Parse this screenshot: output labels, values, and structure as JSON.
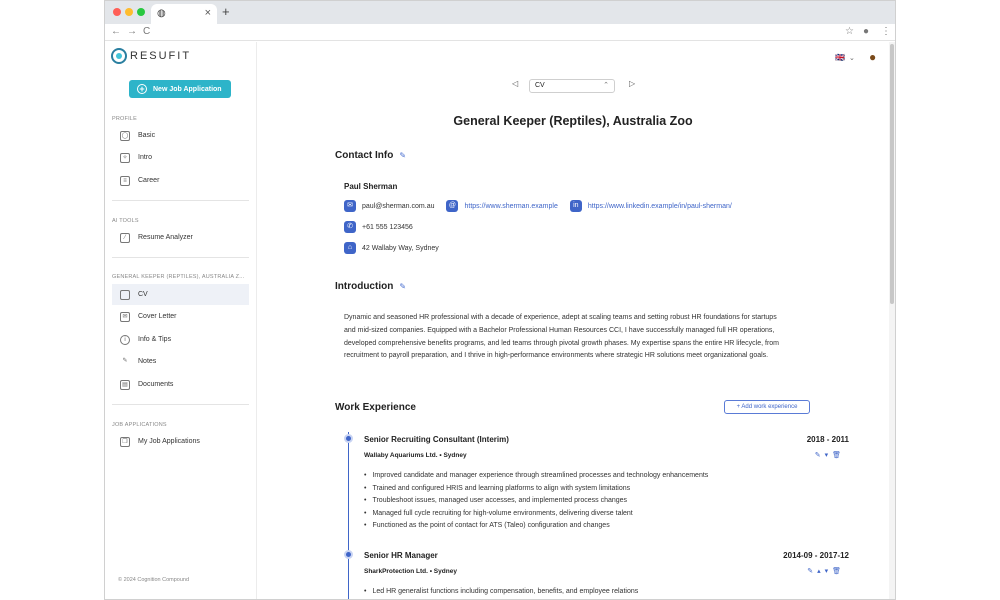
{
  "browser": {
    "tab_icon": "globe-icon",
    "tab_close": "×",
    "new_tab": "+",
    "nav": {
      "back": "←",
      "forward": "→",
      "reload": "C"
    },
    "star": "☆",
    "menu": "⋮"
  },
  "brand": {
    "name": "RESUFIT"
  },
  "sidebar": {
    "new_button": "New Job Application",
    "sections": [
      {
        "label": "PROFILE",
        "items": [
          {
            "label": "Basic",
            "icon": "user-icon"
          },
          {
            "label": "Intro",
            "icon": "sparkle-icon"
          },
          {
            "label": "Career",
            "icon": "list-icon"
          }
        ]
      },
      {
        "label": "AI TOOLS",
        "items": [
          {
            "label": "Resume Analyzer",
            "icon": "wand-icon"
          }
        ]
      },
      {
        "label": "GENERAL KEEPER (REPTILES), AUSTRALIA Z...",
        "items": [
          {
            "label": "CV",
            "icon": "document-icon"
          },
          {
            "label": "Cover Letter",
            "icon": "mail-icon"
          },
          {
            "label": "Info & Tips",
            "icon": "info-icon"
          },
          {
            "label": "Notes",
            "icon": "pencil-icon"
          },
          {
            "label": "Documents",
            "icon": "file-icon"
          }
        ]
      },
      {
        "label": "JOB APPLICATIONS",
        "items": [
          {
            "label": "My Job Applications",
            "icon": "copy-icon"
          }
        ]
      }
    ],
    "copyright": "© 2024 Cognition Compound"
  },
  "topbar": {
    "selector_value": "CV",
    "selector_caret": "⌃",
    "prev": "◁",
    "next": "▷"
  },
  "page_title": "General Keeper (Reptiles), Australia Zoo",
  "contact": {
    "heading": "Contact Info",
    "name": "Paul Sherman",
    "email": "paul@sherman.com.au",
    "website": "https://www.sherman.example",
    "linkedin": "https://www.linkedin.example/in/paul-sherman/",
    "phone": "+61 555 123456",
    "address": "42 Wallaby Way, Sydney"
  },
  "introduction": {
    "heading": "Introduction",
    "text": "Dynamic and seasoned HR professional with a decade of experience, adept at scaling teams and setting robust HR foundations for startups and mid-sized companies. Equipped with a Bachelor Professional Human Resources CCI, I have successfully managed full HR operations, developed comprehensive benefits programs, and led teams through pivotal growth phases. My expertise spans the entire HR lifecycle, from recruitment to payroll preparation, and I thrive in high-performance environments where strategic HR solutions meet organizational goals."
  },
  "work": {
    "heading": "Work Experience",
    "add_button": "+ Add work experience",
    "jobs": [
      {
        "title": "Senior Recruiting Consultant (Interim)",
        "dates": "2018 - 2011",
        "company": "Wallaby Aquariums Ltd. • Sydney",
        "bullets": [
          "Improved candidate and manager experience through streamlined processes and technology enhancements",
          "Trained and configured HRIS and learning platforms to align with system limitations",
          "Troubleshoot issues, managed user accesses, and implemented process changes",
          "Managed full cycle recruiting for high-volume environments, delivering diverse talent",
          "Functioned as the point of contact for ATS (Taleo) configuration and changes"
        ]
      },
      {
        "title": "Senior HR Manager",
        "dates": "2014-09 - 2017-12",
        "company": "SharkProtection Ltd. • Sydney",
        "bullets": [
          "Led HR generalist functions including compensation, benefits, and employee relations"
        ]
      }
    ]
  },
  "colors": {
    "accent": "#3f65c8",
    "brand": "#2db4c9"
  }
}
